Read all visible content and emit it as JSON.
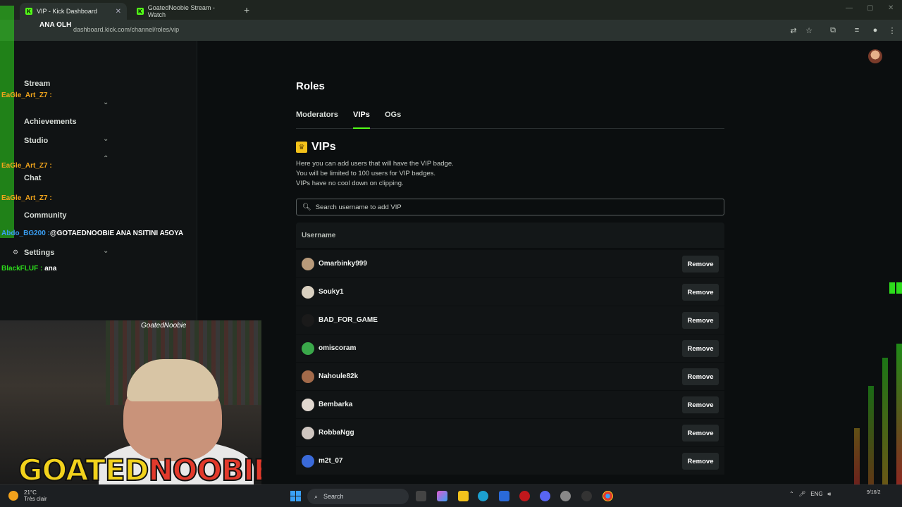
{
  "browser": {
    "tabs": [
      {
        "title": "VIP - Kick Dashboard",
        "active": true
      },
      {
        "title": "GoatedNoobie Stream - Watch",
        "active": false
      }
    ],
    "new_tab": "+",
    "url": "dashboard.kick.com/channel/roles/vip"
  },
  "sidebar": {
    "items": [
      {
        "label": "Stream"
      },
      {
        "label": "Achievements"
      },
      {
        "label": "Studio"
      },
      {
        "label": "Chat"
      },
      {
        "label": "Community"
      },
      {
        "label": "Settings"
      }
    ]
  },
  "main": {
    "title": "Roles",
    "tabs": [
      {
        "label": "Moderators"
      },
      {
        "label": "VIPs",
        "active": true
      },
      {
        "label": "OGs"
      }
    ],
    "section_title": "VIPs",
    "description": [
      "Here you can add users that will have the VIP badge.",
      "You will be limited to 100 users for VIP badges.",
      "VIPs have no cool down on clipping."
    ],
    "search_placeholder": "Search username to add VIP",
    "column_username": "Username",
    "remove_label": "Remove",
    "users": [
      {
        "name": "Omarbinky999",
        "color": "#b89a7a"
      },
      {
        "name": "Souky1",
        "color": "#d9d0c0"
      },
      {
        "name": "BAD_FOR_GAME",
        "color": "#1a1a1a"
      },
      {
        "name": "omiscoram",
        "color": "#3aa84a"
      },
      {
        "name": "Nahoule82k",
        "color": "#a26a4a"
      },
      {
        "name": "Bembarka",
        "color": "#e0d7cf"
      },
      {
        "name": "RobbaNgg",
        "color": "#cfc6c0"
      },
      {
        "name": "m2t_07",
        "color": "#3a6ad9"
      }
    ]
  },
  "overlay": {
    "chat": [
      {
        "name": "",
        "msg": "ANA OLH"
      },
      {
        "name": "EaGle_Art_Z7 :",
        "msg": ""
      },
      {
        "name": "EaGle_Art_Z7 :",
        "msg": ""
      },
      {
        "name": "EaGle_Art_Z7 :",
        "msg": ""
      },
      {
        "name": "Abdo_BG200 :",
        "msg": "@GOTAEDNOOBIE ANA NSITINI A5OYA"
      },
      {
        "name": "BlackFLUF :",
        "msg": "ana"
      }
    ],
    "cam_name": "GoatedNoobie",
    "brand_g": "GOATED",
    "brand_n": "NOOBIE"
  },
  "taskbar": {
    "temp": "21°C",
    "weather": "Très clair",
    "search": "Search",
    "lang": "ENG",
    "date": "9/16/2"
  }
}
